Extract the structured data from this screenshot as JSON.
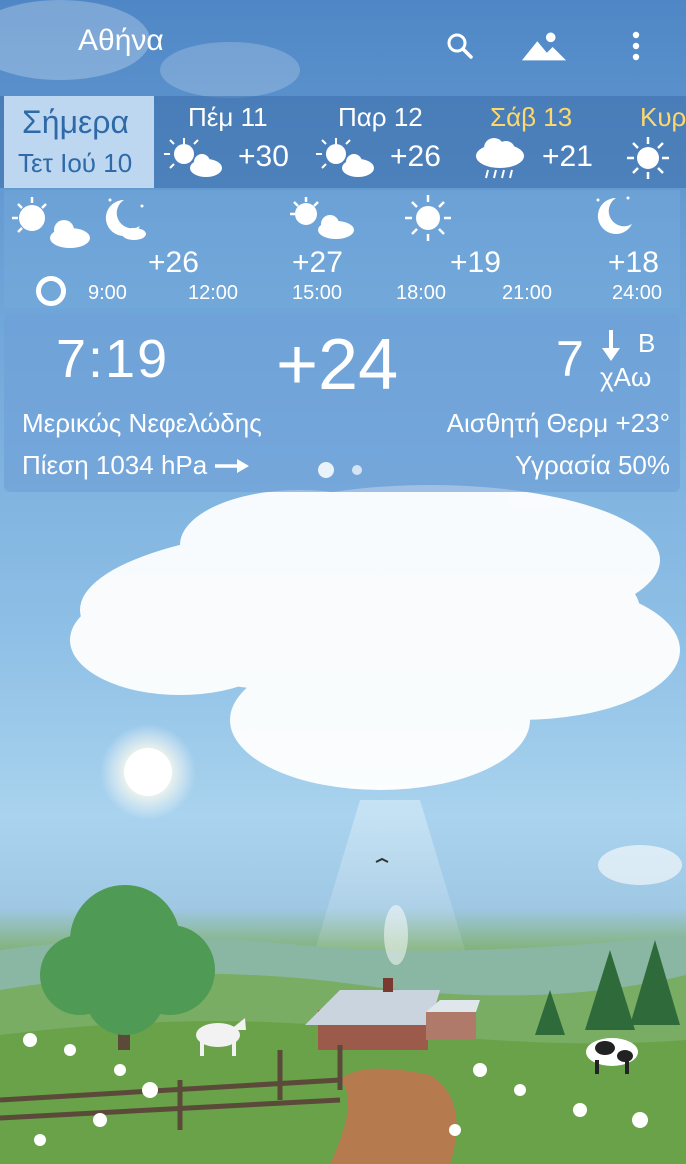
{
  "topbar": {
    "city": "Αθήνα",
    "icons": [
      "search-icon",
      "landscape-icon",
      "more-vert-icon"
    ]
  },
  "days": {
    "today": {
      "label": "Σήμερα",
      "date": "Τετ Ιού 10"
    },
    "items": [
      {
        "name": "Πέμ 11",
        "temp": "+30",
        "icon": "partly-cloudy-icon",
        "weekend": false
      },
      {
        "name": "Παρ 12",
        "temp": "+26",
        "icon": "partly-cloudy-icon",
        "weekend": false
      },
      {
        "name": "Σάβ 13",
        "temp": "+21",
        "icon": "rain-cloud-icon",
        "weekend": true
      },
      {
        "name": "Κυρ",
        "temp": "",
        "icon": "sun-icon",
        "weekend": true
      }
    ]
  },
  "hourly": {
    "times": [
      "9:00",
      "12:00",
      "15:00",
      "18:00",
      "21:00",
      "24:00"
    ],
    "temps": [
      "+26",
      "+27",
      "+19",
      "+18"
    ]
  },
  "current": {
    "time": "7:19",
    "temp": "+24",
    "wind_speed": "7",
    "wind_dir": "Β",
    "wind_unit": "χΑω",
    "condition": "Μερικώς Νεφελώδης",
    "feels_like": "Αισθητή Θερμ +23°",
    "pressure": "Πίεση 1034 hPa",
    "humidity": "Υγρασία 50%"
  },
  "colors": {
    "accent_weekend": "#ffd86b",
    "today_text": "#2f6aa8"
  }
}
